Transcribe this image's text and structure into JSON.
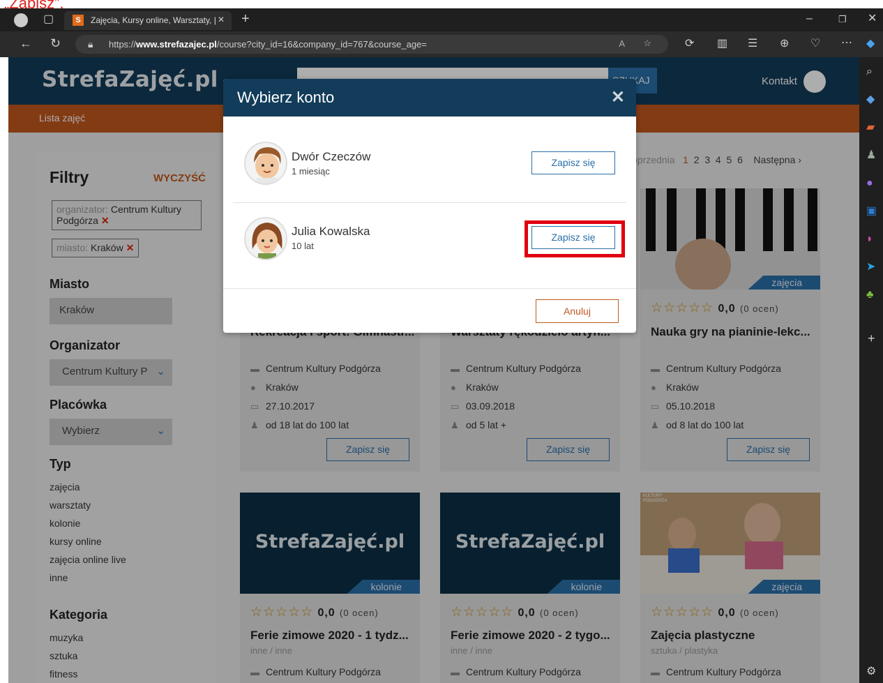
{
  "caption": "„Zapisz”.",
  "browser": {
    "tab_title": "Zajęcia, Kursy online, Warsztaty, |",
    "url_prefix": "https://",
    "url_host": "www.strefazajec.pl",
    "url_path": "/course?city_id=16&company_id=767&course_age="
  },
  "site": {
    "logo": "StrefaZajęć.pl",
    "search_button": "SZUKAJ",
    "contact": "Kontakt",
    "nav_item": "Lista zajęć"
  },
  "filters": {
    "title": "Filtry",
    "clear": "WYCZYŚĆ",
    "chip1_key": "organizator: ",
    "chip1_val": "Centrum Kultury Podgórza",
    "chip2_key": "miasto: ",
    "chip2_val": "Kraków",
    "city_h": "Miasto",
    "city_val": "Kraków",
    "org_h": "Organizator",
    "org_val": "Centrum Kultury P",
    "place_h": "Placówka",
    "place_val": "Wybierz",
    "type_h": "Typ",
    "types": [
      "zajęcia",
      "warsztaty",
      "kolonie",
      "kursy online",
      "zajęcia online live",
      "inne"
    ],
    "cat_h": "Kategoria",
    "cats": [
      "muzyka",
      "sztuka",
      "fitness"
    ]
  },
  "pagination": {
    "prev": "oprzednia",
    "pages": [
      "1",
      "2",
      "3",
      "4",
      "5",
      "6"
    ],
    "next": "Następna"
  },
  "cards_row1": [
    {
      "title": "Rekreacja i sport: Gimnastr...",
      "org": "Centrum Kultury Podgórza",
      "city": "Kraków",
      "date": "27.10.2017",
      "age": "od 18 lat do 100 lat",
      "btn": "Zapisz się"
    },
    {
      "title": "Warsztaty rękodzielo artyh...",
      "org": "Centrum Kultury Podgórza",
      "city": "Kraków",
      "date": "03.09.2018",
      "age": "od 5 lat +",
      "btn": "Zapisz się"
    },
    {
      "badge": "zajęcia",
      "rating": "0,0",
      "reviews": "(0 ocen)",
      "title": "Nauka gry na pianinie-lekc...",
      "org": "Centrum Kultury Podgórza",
      "city": "Kraków",
      "date": "05.10.2018",
      "age": "od 8 lat do 100 lat",
      "btn": "Zapisz się"
    }
  ],
  "cards_row2": [
    {
      "logo": "StrefaZajęć.pl",
      "badge": "kolonie",
      "rating": "0,0",
      "reviews": "(0 ocen)",
      "title": "Ferie zimowe 2020 - 1 tydz...",
      "sub": "inne / inne",
      "org": "Centrum Kultury Podgórza"
    },
    {
      "logo": "StrefaZajęć.pl",
      "badge": "kolonie",
      "rating": "0,0",
      "reviews": "(0 ocen)",
      "title": "Ferie zimowe 2020 - 2 tygo...",
      "sub": "inne / inne",
      "org": "Centrum Kultury Podgórza"
    },
    {
      "badge": "zajęcia",
      "rating": "0,0",
      "reviews": "(0 ocen)",
      "title": "Zajęcia plastyczne",
      "sub": "sztuka / plastyka",
      "org": "Centrum Kultury Podgórza",
      "img_text": "KULTURY PODGÓRZA"
    }
  ],
  "modal": {
    "title": "Wybierz konto",
    "accounts": [
      {
        "name": "Dwór Czeczów",
        "age": "1 miesiąc",
        "btn": "Zapisz się"
      },
      {
        "name": "Julia Kowalska",
        "age": "10 lat",
        "btn": "Zapisz się"
      }
    ],
    "cancel": "Anuluj"
  },
  "colors": {
    "navy": "#123c59",
    "orange": "#c1581c",
    "blue": "#2a6fa8",
    "highlight": "#e00010"
  }
}
